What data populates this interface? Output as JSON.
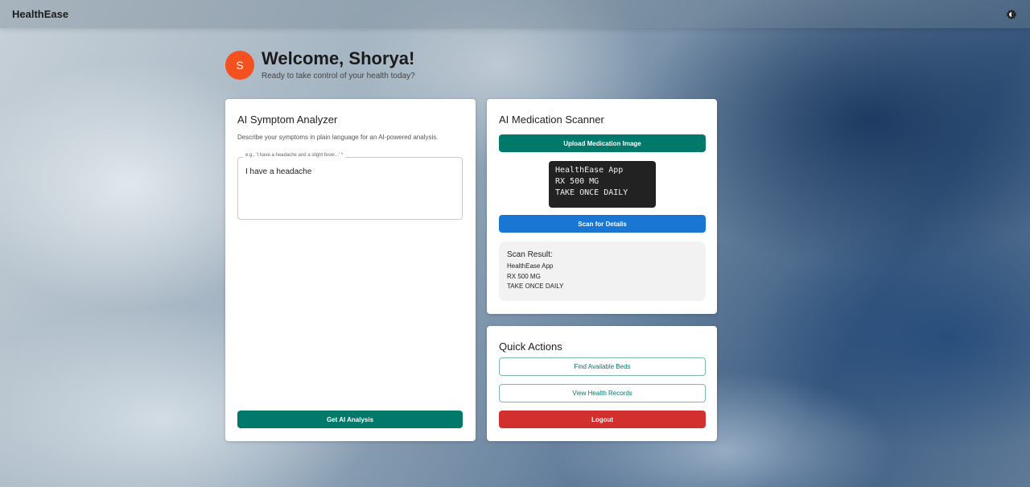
{
  "header": {
    "brand": "HealthEase",
    "theme_icon": "brightness-icon"
  },
  "welcome": {
    "avatar_initial": "S",
    "title": "Welcome, Shorya!",
    "subtitle": "Ready to take control of your health today?",
    "avatar_color": "#f4511e"
  },
  "symptom_analyzer": {
    "title": "AI Symptom Analyzer",
    "description": "Describe your symptoms in plain language for an AI-powered analysis.",
    "input_label": "e.g., 'I have a headache and a slight fever...' *",
    "input_value": "I have a headache",
    "submit_label": "Get AI Analysis"
  },
  "medication_scanner": {
    "title": "AI Medication Scanner",
    "upload_label": "Upload Medication Image",
    "image_lines": [
      "HealthEase App",
      "RX 500 MG",
      "TAKE ONCE DAILY"
    ],
    "scan_label": "Scan for Details",
    "result_title": "Scan Result:",
    "result_lines": [
      "HealthEase App",
      "RX 500 MG",
      "TAKE ONCE DAILY"
    ]
  },
  "quick_actions": {
    "title": "Quick Actions",
    "find_beds_label": "Find Available Beds",
    "records_label": "View Health Records",
    "logout_label": "Logout"
  },
  "colors": {
    "primary": "#00796b",
    "scan": "#1976d2",
    "danger": "#d32f2f"
  }
}
